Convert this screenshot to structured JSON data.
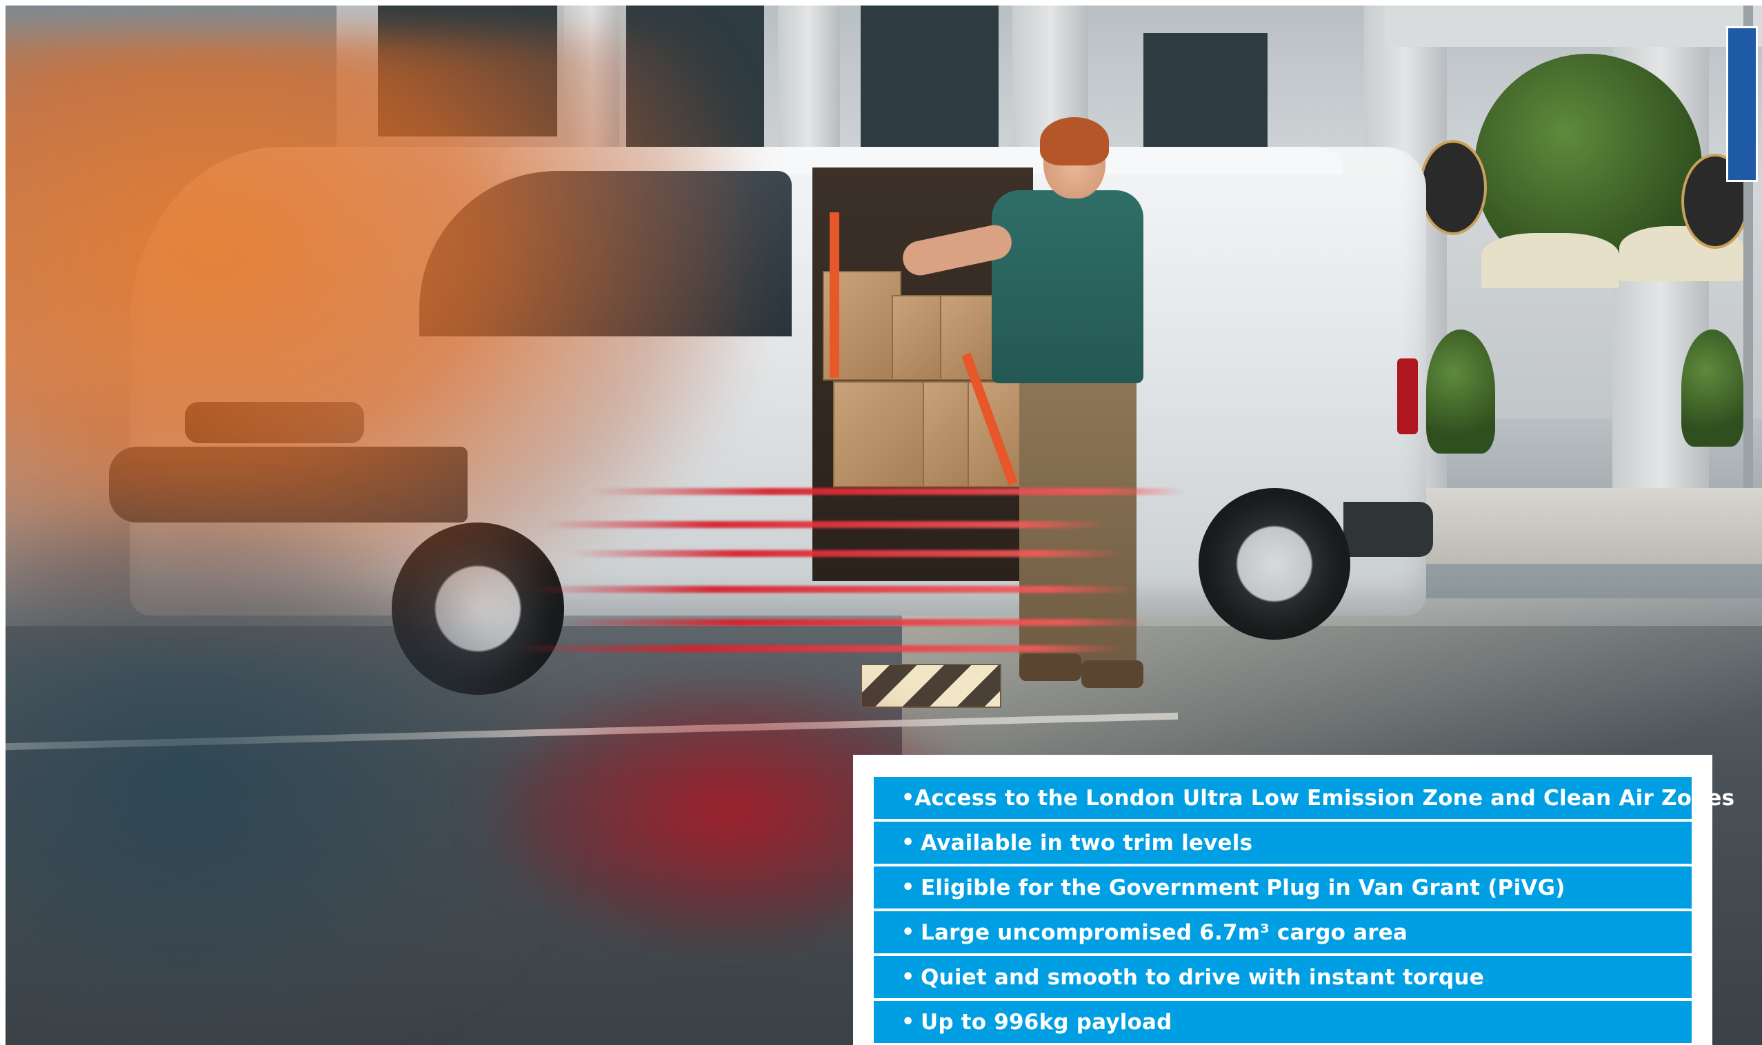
{
  "features": {
    "bullet": "•",
    "items": [
      {
        "text": "Access to the London Ultra Low Emission Zone and Clean Air Zones"
      },
      {
        "text": "Available in two trim levels"
      },
      {
        "text": "Eligible for the Government Plug in Van Grant (PiVG)"
      },
      {
        "text": "Large uncompromised 6.7m³ cargo area"
      },
      {
        "text": "Quiet and smooth to drive with instant torque"
      },
      {
        "text": "Up to 996kg payload"
      }
    ]
  },
  "colors": {
    "feature_bar": "#009fe3",
    "feature_text": "#ffffff",
    "motion_orange": "#e4782a",
    "motion_red": "#d6222e",
    "van_white": "#f4f5f6"
  },
  "icons": {
    "sign": "parking-sign-icon"
  }
}
